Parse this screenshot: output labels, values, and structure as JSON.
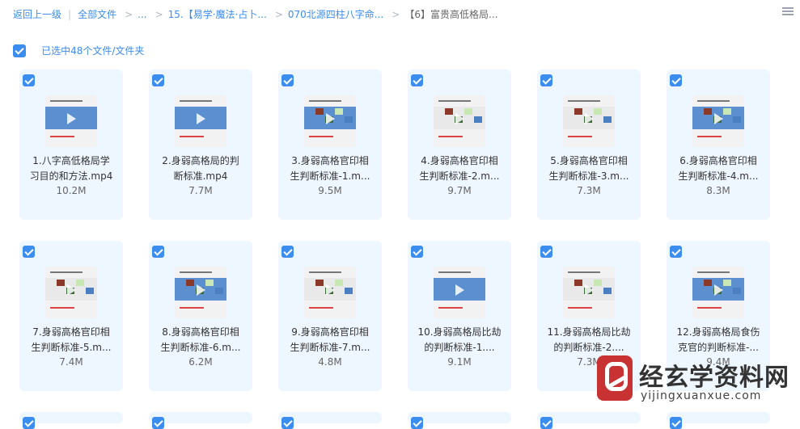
{
  "breadcrumb": {
    "back": "返回上一级",
    "all": "全部文件",
    "ellipsis": "...",
    "level1": "15.【易学·魔法·占卜...",
    "level2": "070北源四柱八字命...",
    "current": "【6】富贵高低格局..."
  },
  "selection": {
    "label": "已选中48个文件/文件夹"
  },
  "files": [
    {
      "line1": "1.八字高低格局学",
      "line2": "习目的和方法.mp4",
      "size": "10.2M"
    },
    {
      "line1": "2.身弱高格局的判",
      "line2": "断标准.mp4",
      "size": "7.7M"
    },
    {
      "line1": "3.身弱高格官印相",
      "line2": "生判断标准-1.m...",
      "size": "9.5M"
    },
    {
      "line1": "4.身弱高格官印相",
      "line2": "生判断标准-2.m...",
      "size": "9.7M"
    },
    {
      "line1": "5.身弱高格官印相",
      "line2": "生判断标准-3.m...",
      "size": "7.3M"
    },
    {
      "line1": "6.身弱高格官印相",
      "line2": "生判断标准-4.m...",
      "size": "8.3M"
    },
    {
      "line1": "7.身弱高格官印相",
      "line2": "生判断标准-5.m...",
      "size": "7.4M"
    },
    {
      "line1": "8.身弱高格官印相",
      "line2": "生判断标准-6.m...",
      "size": "6.2M"
    },
    {
      "line1": "9.身弱高格官印相",
      "line2": "生判断标准-7.m...",
      "size": "4.8M"
    },
    {
      "line1": "10.身弱高格局比劫",
      "line2": "的判断标准-1....",
      "size": "9.1M"
    },
    {
      "line1": "11.身弱高格局比劫",
      "line2": "的判断标准-2....",
      "size": "7.3M"
    },
    {
      "line1": "12.身弱高格局食伤",
      "line2": "克官的判断标准-...",
      "size": "9.4M"
    }
  ],
  "watermark": {
    "title": "经玄学资料网",
    "url": "yijingxuanxue.com"
  },
  "colors": {
    "accent": "#3b8df0",
    "card_bg": "#eef6ff",
    "logo_red": "#c83232"
  }
}
